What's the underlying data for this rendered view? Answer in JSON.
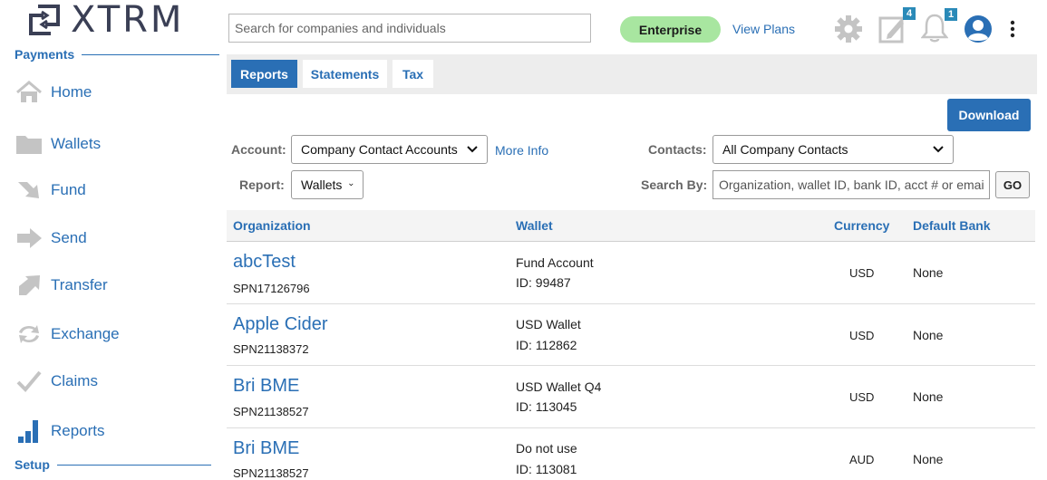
{
  "brand": {
    "logo_text": "XTRM"
  },
  "sidebar": {
    "payments_header": "Payments",
    "setup_header": "Setup",
    "items": [
      {
        "label": "Home",
        "icon": "home-icon"
      },
      {
        "label": "Wallets",
        "icon": "folder-icon"
      },
      {
        "label": "Fund",
        "icon": "fund-arrow-icon"
      },
      {
        "label": "Send",
        "icon": "send-arrow-icon"
      },
      {
        "label": "Transfer",
        "icon": "transfer-arrow-icon"
      },
      {
        "label": "Exchange",
        "icon": "exchange-icon"
      },
      {
        "label": "Claims",
        "icon": "checkmark-icon"
      },
      {
        "label": "Reports",
        "icon": "bar-chart-icon"
      }
    ]
  },
  "header": {
    "search_placeholder": "Search for companies and individuals",
    "plan_badge": "Enterprise",
    "view_plans": "View Plans",
    "tasks_count": "4",
    "notifications_count": "1"
  },
  "tabs": [
    {
      "label": "Reports",
      "active": true
    },
    {
      "label": "Statements",
      "active": false
    },
    {
      "label": "Tax",
      "active": false
    }
  ],
  "toolbar": {
    "download": "Download"
  },
  "filters": {
    "account_label": "Account:",
    "account_value": "Company Contact Accounts",
    "more_info": "More Info",
    "contacts_label": "Contacts:",
    "contacts_value": "All Company Contacts",
    "report_label": "Report:",
    "report_value": "Wallets",
    "search_by_label": "Search By:",
    "search_by_placeholder": "Organization, wallet ID, bank ID, acct # or email",
    "go": "GO"
  },
  "table": {
    "columns": [
      "Organization",
      "Wallet",
      "Currency",
      "Default Bank"
    ],
    "rows": [
      {
        "org": "abcTest",
        "org_id": "SPN17126796",
        "wallet": "Fund Account",
        "wallet_id": "ID: 99487",
        "currency": "USD",
        "bank": "None"
      },
      {
        "org": "Apple Cider",
        "org_id": "SPN21138372",
        "wallet": "USD Wallet",
        "wallet_id": "ID: 112862",
        "currency": "USD",
        "bank": "None"
      },
      {
        "org": "Bri BME",
        "org_id": "SPN21138527",
        "wallet": "USD Wallet Q4",
        "wallet_id": "ID: 113045",
        "currency": "USD",
        "bank": "None"
      },
      {
        "org": "Bri BME",
        "org_id": "SPN21138527",
        "wallet": "Do not use",
        "wallet_id": "ID: 113081",
        "currency": "AUD",
        "bank": "None"
      }
    ]
  },
  "colors": {
    "accent": "#2a6fb5",
    "badge_green": "#a8e6a0",
    "icon_gray": "#c4c4c4"
  }
}
